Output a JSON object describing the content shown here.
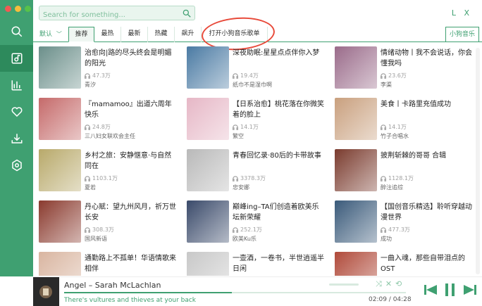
{
  "window": {
    "traffic_colors": [
      "#f25a53",
      "#f6bd3d",
      "#57c24a"
    ]
  },
  "header": {
    "search_placeholder": "Search for something...",
    "window_buttons": "L X"
  },
  "sidebar": {
    "accent": "#3fa071",
    "items": [
      {
        "icon": "search-icon"
      },
      {
        "icon": "music-library-icon",
        "active": true
      },
      {
        "icon": "chart-icon"
      },
      {
        "icon": "heart-icon"
      },
      {
        "icon": "download-icon"
      },
      {
        "icon": "settings-icon"
      }
    ]
  },
  "tabs": {
    "default_label": "默认",
    "items": [
      "推荐",
      "最热",
      "最新",
      "热藏",
      "飙升",
      "打开小狗音乐歌单"
    ],
    "selected_index": 0,
    "source_label": "小狗音乐"
  },
  "playlists": [
    {
      "title": "治愈向|路的尽头终会是明媚的阳光",
      "count": "47.3万",
      "author": "青汐",
      "color": "#6b8f8a"
    },
    {
      "title": "深夜助眠:星星点点伴你入梦",
      "count": "19.4万",
      "author": "纸巾不是湿巾啊",
      "color": "#4a7aa3"
    },
    {
      "title": "情绪动物丨我不会说话，你会懂我吗",
      "count": "23.6万",
      "author": "李渠",
      "color": "#9a6b8a"
    },
    {
      "title": "『mamamoo』出道六周年快乐",
      "count": "24.8万",
      "author": "三八妇女联欢会主任",
      "color": "#c56a6a"
    },
    {
      "title": "【日系治愈】桃花落在你微笑着的脸上",
      "count": "14.1万",
      "author": "繁空",
      "color": "#e6b7c6"
    },
    {
      "title": "美食丨卡路里充值成功",
      "count": "14.1万",
      "author": "竹子合唱水",
      "color": "#c9a07e"
    },
    {
      "title": "乡村之旅：安静惬意·与自然同在",
      "count": "1103.1万",
      "author": "夏若",
      "color": "#b8a96a"
    },
    {
      "title": "青春回忆录·80后的卡带故事",
      "count": "3378.3万",
      "author": "忠安娜",
      "color": "#b9b9b9"
    },
    {
      "title": "披荆斩棘的哥哥 合辑",
      "count": "1128.1万",
      "author": "醉注追综",
      "color": "#7a3b2e"
    },
    {
      "title": "丹心赋：望九州风月，祈万世长安",
      "count": "308.3万",
      "author": "国风新语",
      "color": "#8a3a2e"
    },
    {
      "title": "巅峰ing–TA们创造着欧美乐坛新荣耀",
      "count": "252.1万",
      "author": "欧美Ku乐",
      "color": "#3a4a6a"
    },
    {
      "title": "【国创音乐精选】聆听穿越动漫世界",
      "count": "477.3万",
      "author": "成功",
      "color": "#3a5a7a"
    },
    {
      "title": "通勤路上不孤单！华语情歌来相伴",
      "count": "",
      "author": "",
      "color": "#d9b5a0"
    },
    {
      "title": "一壶酒，一卷书，半世逍遥半日闲",
      "count": "",
      "author": "",
      "color": "#c8c8c8"
    },
    {
      "title": "一曲入魂，那些自带泪点的OST",
      "count": "",
      "author": "",
      "color": "#b04a3a"
    }
  ],
  "player": {
    "song": "Angel – Sarah McLachlan",
    "lyric": "There's vultures and thieves at your back",
    "time": "02:09 / 04:28",
    "progress": 0.49
  }
}
